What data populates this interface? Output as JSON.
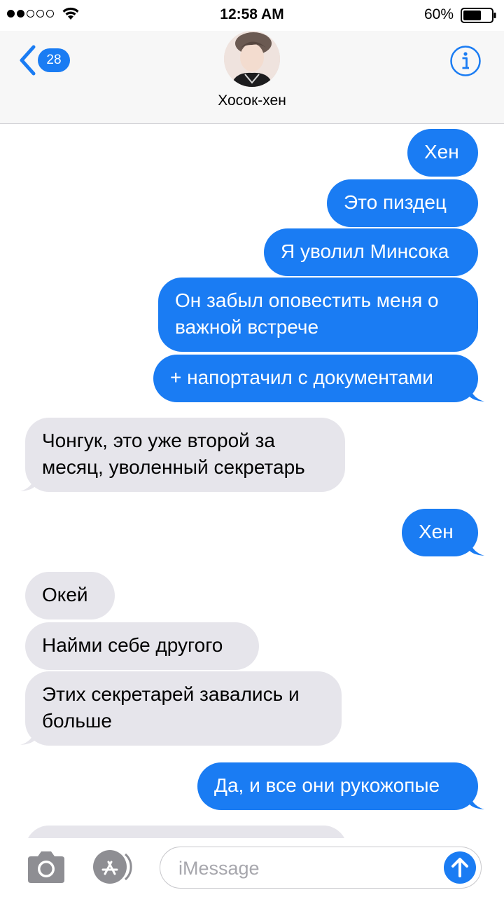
{
  "status_bar": {
    "time": "12:58 AM",
    "battery_percent": "60%",
    "signal_bars": 2,
    "signal_total": 5,
    "battery_level": 0.6
  },
  "header": {
    "back_badge": "28",
    "contact_name": "Хосок-хен",
    "accent_color": "#1a7cf3"
  },
  "messages": [
    {
      "dir": "out",
      "text": "Хен"
    },
    {
      "dir": "out",
      "text": "Это пиздец"
    },
    {
      "dir": "out",
      "text": "Я уволил Минсока"
    },
    {
      "dir": "out",
      "text": "Он забыл оповестить меня о важной встрече"
    },
    {
      "dir": "out",
      "text": "+ напортачил с документами"
    },
    {
      "dir": "in",
      "text": "Чонгук, это уже второй за месяц, уволенный секретарь"
    },
    {
      "dir": "out",
      "text": "Хен"
    },
    {
      "dir": "in",
      "text": "Окей"
    },
    {
      "dir": "in",
      "text": "Найми себе другого"
    },
    {
      "dir": "in",
      "text": "Этих секретарей завались и больше"
    },
    {
      "dir": "out",
      "text": "Да, и все они рукожопые"
    },
    {
      "dir": "in",
      "text": ""
    }
  ],
  "input": {
    "placeholder": "iMessage",
    "value": ""
  },
  "icons": {
    "camera": "camera-icon",
    "apps": "app-store-icon",
    "send": "send-arrow-icon",
    "info": "info-icon",
    "back": "chevron-left-icon"
  }
}
